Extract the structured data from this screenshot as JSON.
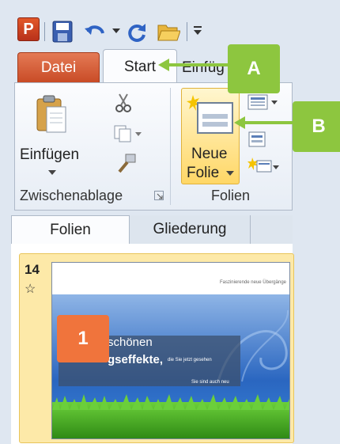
{
  "quick_access": {
    "app_icon_letter": "P",
    "icons": [
      "powerpoint-icon",
      "save-icon",
      "undo-icon",
      "redo-icon",
      "open-folder-icon",
      "customize-toolbar-icon"
    ]
  },
  "tabs": {
    "file": "Datei",
    "start": "Start",
    "insert_partial": "Einfüg"
  },
  "ribbon": {
    "paste_label": "Einfügen",
    "clipboard_group": "Zwischenablage",
    "new_slide_line1": "Neue",
    "new_slide_line2": "Folie",
    "slides_group": "Folien"
  },
  "callouts": {
    "a": "A",
    "b": "B",
    "one": "1"
  },
  "pane": {
    "tab_slides": "Folien",
    "tab_outline": "Gliederung"
  },
  "slide": {
    "number": "14",
    "transition_marker": "☆",
    "header_text": "Faszinierende neue Übergänge",
    "line1": "schönen",
    "line2": "gseffekte,",
    "line2_small": "die Sie jetzt gesehen",
    "line3": "Sie sind auch neu"
  },
  "colors": {
    "callout_green": "#8dc63f",
    "callout_orange": "#f0743c",
    "file_tab": "#c84a25"
  }
}
